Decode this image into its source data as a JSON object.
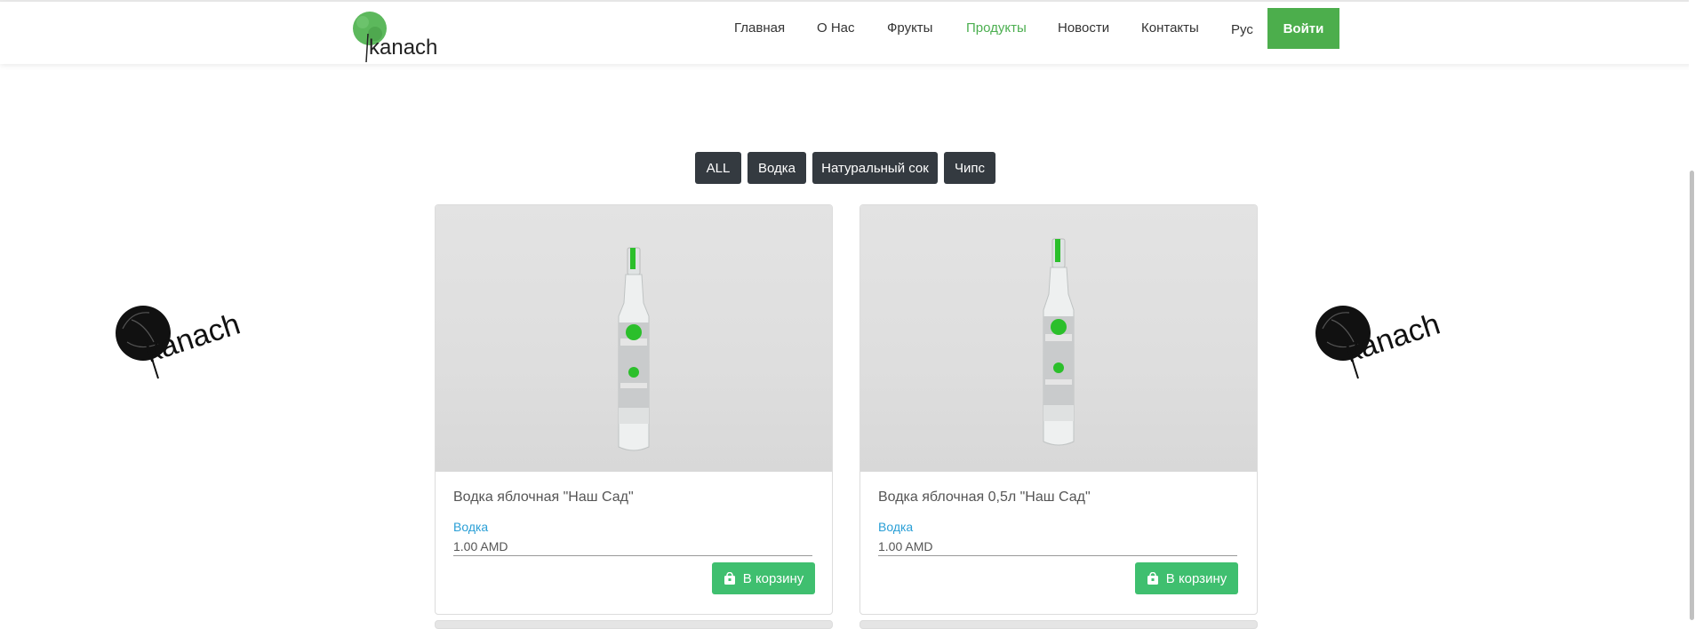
{
  "header": {
    "brand": "kanach",
    "nav": [
      {
        "label": "Главная",
        "active": false
      },
      {
        "label": "О Нас",
        "active": false
      },
      {
        "label": "Фрукты",
        "active": false
      },
      {
        "label": "Продукты",
        "active": true
      },
      {
        "label": "Новости",
        "active": false
      },
      {
        "label": "Контакты",
        "active": false
      },
      {
        "label": "Рус",
        "active": false
      }
    ],
    "login_label": "Войти"
  },
  "filters": [
    "ALL",
    "Водка",
    "Натуральный сок",
    "Чипс"
  ],
  "side_brand": "kanach",
  "products": [
    {
      "title": "Водка яблочная \"Наш Сад\"",
      "category": "Водка",
      "price": "1.00 AMD",
      "cart_label": "В корзину"
    },
    {
      "title": "Водка яблочная 0,5л \"Наш Сад\"",
      "category": "Водка",
      "price": "1.00 AMD",
      "cart_label": "В корзину"
    }
  ],
  "colors": {
    "accent": "#4cae4c",
    "active_nav": "#4caf50",
    "filter_bg": "#343a40",
    "cart_bg": "#3fbf6f",
    "category_link": "#2a9fd6"
  },
  "icons": {
    "cart": "shopping-bag-icon"
  }
}
